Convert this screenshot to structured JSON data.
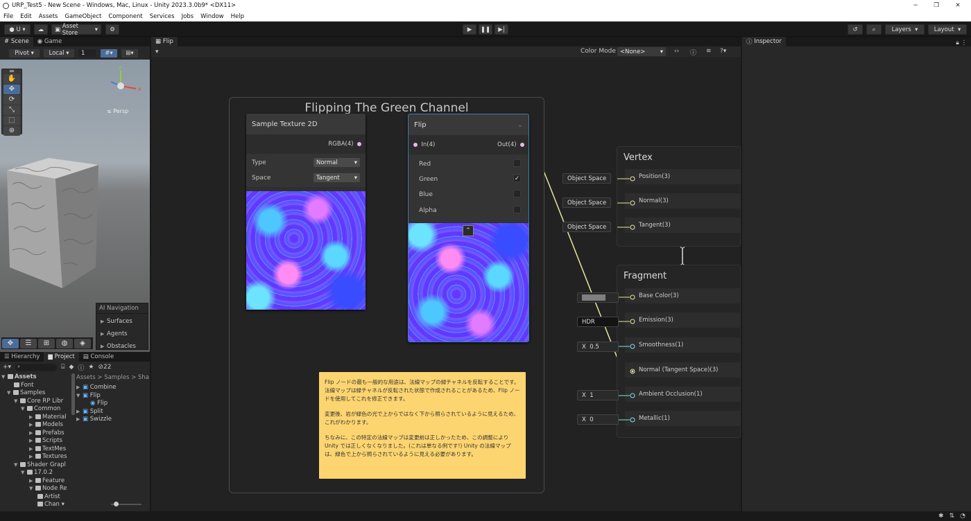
{
  "window": {
    "title": "URP_Test5 - New Scene - Windows, Mac, Linux - Unity 2023.3.0b9* <DX11>"
  },
  "menu": [
    "File",
    "Edit",
    "Assets",
    "GameObject",
    "Component",
    "Services",
    "Jobs",
    "Window",
    "Help"
  ],
  "toolbar": {
    "account": "U",
    "asset_store": "Asset Store",
    "layers": "Layers",
    "layout": "Layout"
  },
  "scene": {
    "tab_scene": "Scene",
    "tab_game": "Game",
    "pivot": "Pivot",
    "local": "Local",
    "grid_value": "1",
    "persp": "≤ Persp",
    "overlay_title": "AI Navigation",
    "overlay_items": [
      "Surfaces",
      "Agents",
      "Obstacles"
    ]
  },
  "hierarchy": {
    "tab_hierarchy": "Hierarchy",
    "tab_project": "Project",
    "tab_console": "Console",
    "count": "22",
    "breadcrumb": "Assets > Samples > Sha",
    "tree": [
      "Assets",
      "Font",
      "Samples",
      "Core RP Libr",
      "Common",
      "Material",
      "Models",
      "Prefabs",
      "Scripts",
      "TextMes",
      "Textures",
      "Shader Grapl",
      "17.0.2",
      "Feature",
      "Node Re",
      "Artist",
      "Chan"
    ],
    "files": [
      "Combine",
      "Flip",
      "Flip",
      "Split",
      "Swizzle"
    ]
  },
  "graph": {
    "tab": "Flip",
    "color_mode_label": "Color Mode",
    "color_mode_value": "<None>",
    "group_title": "Flipping The Green Channel",
    "sample_node": {
      "title": "Sample Texture 2D",
      "out_port": "RGBA(4)",
      "type_label": "Type",
      "type_value": "Normal",
      "space_label": "Space",
      "space_value": "Tangent"
    },
    "flip_node": {
      "title": "Flip",
      "in_port": "In(4)",
      "out_port": "Out(4)",
      "channels": [
        "Red",
        "Green",
        "Blue",
        "Alpha"
      ],
      "checked": [
        false,
        true,
        false,
        false
      ]
    },
    "vertex": {
      "title": "Vertex",
      "ports": [
        "Position(3)",
        "Normal(3)",
        "Tangent(3)"
      ],
      "inputs": [
        "Object Space",
        "Object Space",
        "Object Space"
      ]
    },
    "fragment": {
      "title": "Fragment",
      "ports": [
        "Base Color(3)",
        "Emission(3)",
        "Smoothness(1)",
        "Normal (Tangent Space)(3)",
        "Ambient Occlusion(1)",
        "Metallic(1)"
      ],
      "emission": "HDR",
      "x": "X",
      "smoothness": "0.5",
      "ao": "1",
      "metallic": "0"
    },
    "note": [
      "Flip ノードの最も一般的な用途は、法線マップの緑チャネルを反転することです。法線マップは緑チャネルが反転された状態で作成されることがあるため、Flip ノードを使用してこれを修正できます。",
      "変更後、岩が緑色の光で上からではなく下から照らされているように見えるため、これがわかります。",
      "ちなみに、この特定の法線マップは変更前は正しかったため、この調整によりUnity では正しくなくなりました。(これは単なる例です!) Unity の法線マップは、緑色で上から照らされているように見える必要があります。"
    ]
  },
  "inspector": {
    "tab": "Inspector"
  },
  "colors": {
    "port_pink": "#e8b8e8",
    "port_yellow": "#e8e7a0",
    "port_cyan": "#84e4e7",
    "note": "#fdd570"
  }
}
